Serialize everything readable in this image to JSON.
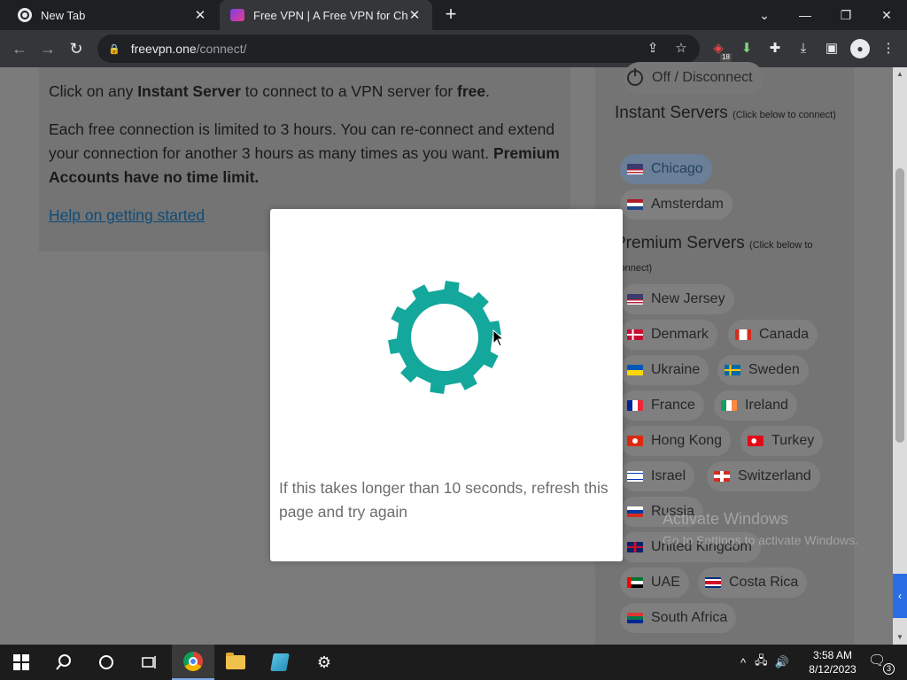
{
  "browser": {
    "tabs": [
      {
        "title": "New Tab",
        "active": false
      },
      {
        "title": "Free VPN | A Free VPN for Chrom",
        "active": true
      }
    ],
    "url_host": "freevpn.one",
    "url_path": "/connect/",
    "extension_badge": "18"
  },
  "main": {
    "para1_a": "Click on any ",
    "para1_b": "Instant Server",
    "para1_c": " to connect to a VPN server for ",
    "para1_d": "free",
    "para1_e": ".",
    "para2": "Each free connection is limited to 3 hours. You can re-connect and extend your connection for another 3 hours as many times as you want. ",
    "para2_bold": "Premium Accounts have no time limit.",
    "help_link": "Help on getting started"
  },
  "side": {
    "off_label": "Off / Disconnect",
    "instant_title": "Instant Servers",
    "instant_hint": "(Click below to connect)",
    "premium_title": "Premium Servers",
    "premium_hint": "(Click below to connect)",
    "instant": [
      {
        "name": "Chicago",
        "flag": "us",
        "active": true
      },
      {
        "name": "Amsterdam",
        "flag": "nl"
      }
    ],
    "premium": [
      {
        "name": "New Jersey",
        "flag": "us"
      },
      {
        "name": "Denmark",
        "flag": "dk"
      },
      {
        "name": "Canada",
        "flag": "ca"
      },
      {
        "name": "Ukraine",
        "flag": "ua"
      },
      {
        "name": "Sweden",
        "flag": "se"
      },
      {
        "name": "France",
        "flag": "fr"
      },
      {
        "name": "Ireland",
        "flag": "ie"
      },
      {
        "name": "Hong Kong",
        "flag": "hk"
      },
      {
        "name": "Turkey",
        "flag": "tr"
      },
      {
        "name": "Israel",
        "flag": "il"
      },
      {
        "name": "Switzerland",
        "flag": "ch"
      },
      {
        "name": "Russia",
        "flag": "ru"
      },
      {
        "name": "United Kingdom",
        "flag": "gb"
      },
      {
        "name": "UAE",
        "flag": "ae"
      },
      {
        "name": "Costa Rica",
        "flag": "cr"
      },
      {
        "name": "South Africa",
        "flag": "za"
      }
    ]
  },
  "modal": {
    "message": "If this takes longer than 10 seconds, refresh this page and try again",
    "gear_color": "#14a79c"
  },
  "watermark": {
    "line1": "Activate Windows",
    "line2": "Go to Settings to activate Windows."
  },
  "taskbar": {
    "time": "3:58 AM",
    "date": "8/12/2023",
    "notification_count": "3"
  }
}
